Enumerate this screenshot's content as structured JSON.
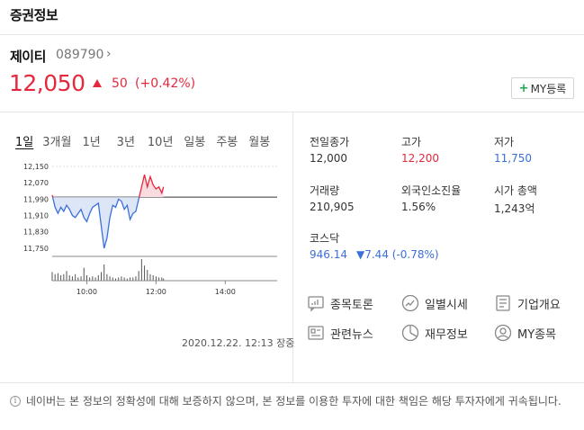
{
  "header": {
    "title": "증권정보"
  },
  "stock": {
    "name": "제이티",
    "code": "089790",
    "chevron": "›",
    "price": "12,050",
    "change": "50",
    "change_pct": "(+0.42%)",
    "my_button": "MY등록",
    "my_button_plus": "+"
  },
  "colors": {
    "up": "#e5283c",
    "down": "#3b6fd9",
    "accent_green": "#1fa64a"
  },
  "periods": [
    "1일",
    "3개월",
    "1년",
    "3년",
    "10년",
    "일봉",
    "주봉",
    "월봉"
  ],
  "active_period": "1일",
  "chart_data": {
    "type": "line",
    "title": "",
    "xlabel": "",
    "ylabel": "",
    "y_ticks": [
      "12,150",
      "12,070",
      "11,990",
      "11,910",
      "11,830",
      "11,750"
    ],
    "x_ticks": [
      "10:00",
      "12:00",
      "14:00"
    ],
    "ylim": [
      11710,
      12150
    ],
    "baseline": 12000,
    "x": [
      "09:00",
      "09:05",
      "09:10",
      "09:15",
      "09:20",
      "09:25",
      "09:30",
      "09:35",
      "09:40",
      "09:45",
      "09:50",
      "09:55",
      "10:00",
      "10:05",
      "10:10",
      "10:15",
      "10:20",
      "10:25",
      "10:30",
      "10:35",
      "10:40",
      "10:45",
      "10:50",
      "10:55",
      "11:00",
      "11:05",
      "11:10",
      "11:15",
      "11:20",
      "11:25",
      "11:30",
      "11:35",
      "11:40",
      "11:45",
      "11:50",
      "11:55",
      "12:00",
      "12:05",
      "12:10",
      "12:13"
    ],
    "series": [
      {
        "values": [
          12010,
          11950,
          11920,
          11950,
          11930,
          11960,
          11940,
          11910,
          11900,
          11920,
          11940,
          11900,
          11880,
          11920,
          11950,
          11960,
          11970,
          11860,
          11750,
          11800,
          11900,
          11960,
          11950,
          11990,
          11980,
          11940,
          11960,
          11890,
          11920,
          11930,
          11990,
          12050,
          12110,
          12050,
          12100,
          12060,
          12040,
          12050,
          12020,
          12050
        ]
      }
    ],
    "volume": [
      8,
      6,
      7,
      5,
      6,
      9,
      5,
      4,
      6,
      3,
      4,
      12,
      5,
      3,
      4,
      3,
      5,
      8,
      15,
      6,
      4,
      3,
      2,
      3,
      4,
      3,
      2,
      3,
      3,
      4,
      9,
      20,
      14,
      10,
      6,
      5,
      4,
      3,
      3,
      2
    ],
    "timestamp": "2020.12.22. 12:13 장중"
  },
  "stats": {
    "prev_close": {
      "label": "전일종가",
      "value": "12,000"
    },
    "high": {
      "label": "고가",
      "value": "12,200"
    },
    "low": {
      "label": "저가",
      "value": "11,750"
    },
    "volume": {
      "label": "거래량",
      "value": "210,905"
    },
    "foreign": {
      "label": "외국인소진율",
      "value": "1.56%"
    },
    "market_cap": {
      "label": "시가 총액",
      "value": "1,243억"
    },
    "kosdaq_label": "코스닥",
    "kosdaq_value": "946.14",
    "kosdaq_change": "▼7.44 (-0.78%)"
  },
  "links": [
    {
      "label": "종목토론",
      "icon": "discussion-icon"
    },
    {
      "label": "일별시세",
      "icon": "trend-icon"
    },
    {
      "label": "기업개요",
      "icon": "company-icon"
    },
    {
      "label": "관련뉴스",
      "icon": "news-icon"
    },
    {
      "label": "재무정보",
      "icon": "pie-icon"
    },
    {
      "label": "MY종목",
      "icon": "user-icon"
    }
  ],
  "disclaimer": "네이버는 본 정보의 정확성에 대해 보증하지 않으며, 본 정보를 이용한 투자에 대한 책임은 해당 투자자에게 귀속됩니다."
}
